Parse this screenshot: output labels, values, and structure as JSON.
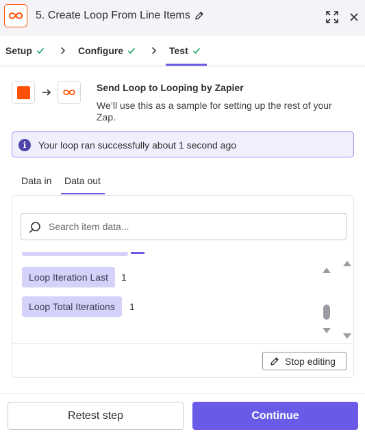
{
  "header": {
    "step_title": "5. Create Loop From Line Items",
    "app_icon": "looping-icon",
    "accent_color": "#ff4f00"
  },
  "steps": {
    "items": [
      {
        "label": "Setup",
        "status": "complete"
      },
      {
        "label": "Configure",
        "status": "complete"
      },
      {
        "label": "Test",
        "status": "complete",
        "active": true
      }
    ],
    "check_color": "#13a35f",
    "active_color": "#695be8"
  },
  "app_row": {
    "title": "Send Loop to Looping by Zapier",
    "description": "We’ll use this as a sample for setting up the rest of your Zap."
  },
  "banner": {
    "text": "Your loop ran successfully about 1 second ago",
    "icon": "info-icon"
  },
  "data_tabs": {
    "items": [
      "Data in",
      "Data out"
    ],
    "active": "Data out"
  },
  "search": {
    "placeholder": "Search item data...",
    "value": ""
  },
  "fields": [
    {
      "label": "Loop Iteration Last",
      "value": "1"
    },
    {
      "label": "Loop Total Iterations",
      "value": "1"
    }
  ],
  "stop_editing_label": "Stop editing",
  "footer": {
    "retest_label": "Retest step",
    "continue_label": "Continue",
    "primary_color": "#695be8"
  }
}
